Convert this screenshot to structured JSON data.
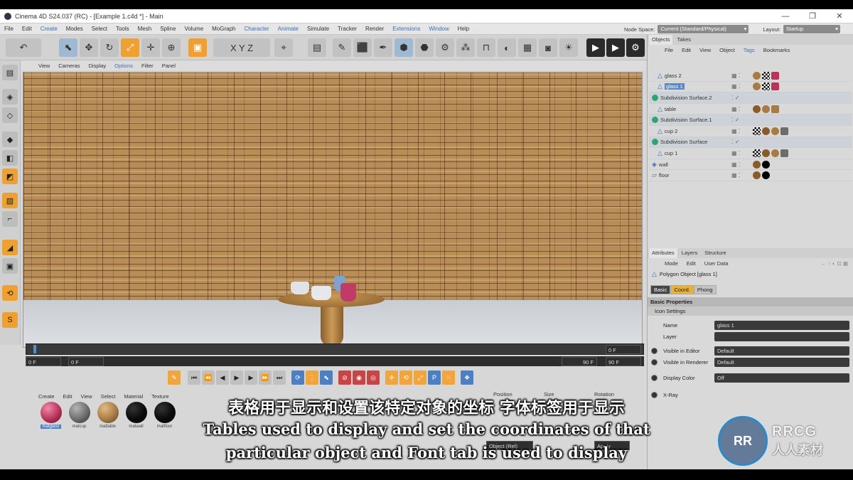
{
  "window": {
    "title": "Cinema 4D S24.037 (RC) - [Example 1.c4d *] - Main",
    "controls": [
      "—",
      "❐",
      "✕"
    ]
  },
  "menubar": {
    "items": [
      "File",
      "Edit",
      "Create",
      "Modes",
      "Select",
      "Tools",
      "Mesh",
      "Spline",
      "Volume",
      "MoGraph",
      "Character",
      "Animate",
      "Simulate",
      "Tracker",
      "Render",
      "Extensions",
      "Window",
      "Help"
    ],
    "node_space_label": "Node Space:",
    "node_space_value": "Current (Standard/Physical)",
    "layout_label": "Layout:",
    "layout_value": "Startup"
  },
  "viewport_menu": [
    "View",
    "Cameras",
    "Display",
    "Options",
    "Filter",
    "Panel"
  ],
  "timeline": {
    "start_field": "0 F",
    "current_field": "0 F",
    "end_field": "90 F",
    "end_field_right": "90 F",
    "top_right_field": "0 F"
  },
  "material_menu": [
    "Create",
    "Edit",
    "View",
    "Select",
    "Material",
    "Texture"
  ],
  "materials": [
    {
      "name": "matglass",
      "color": "#b8345a"
    },
    {
      "name": "matcup",
      "color": "#6d6d6d"
    },
    {
      "name": "mattable",
      "color": "#a87b45"
    },
    {
      "name": "matwall",
      "color": "#0a0a0a"
    },
    {
      "name": "matfloor",
      "color": "#0a0a0a"
    }
  ],
  "coords": {
    "position": "Position",
    "size": "Size",
    "rotation": "Rotation",
    "object_mode": "Object (Rel)",
    "apply": "Apply"
  },
  "objects_panel": {
    "tabs": [
      "Objects",
      "Takes"
    ],
    "menu": [
      "File",
      "Edit",
      "View",
      "Object",
      "Tags",
      "Bookmarks"
    ],
    "rows": [
      {
        "name": "glass 2",
        "indent": 1,
        "type": "tri"
      },
      {
        "name": "glass 1",
        "indent": 1,
        "type": "tri"
      },
      {
        "name": "Subdivision Surface.2",
        "indent": 0,
        "type": "sub"
      },
      {
        "name": "table",
        "indent": 1,
        "type": "tri"
      },
      {
        "name": "Subdivision Surface.1",
        "indent": 0,
        "type": "sub"
      },
      {
        "name": "cup 2",
        "indent": 1,
        "type": "tri"
      },
      {
        "name": "Subdivision Surface",
        "indent": 0,
        "type": "sub"
      },
      {
        "name": "cup 1",
        "indent": 1,
        "type": "tri"
      },
      {
        "name": "wall",
        "indent": 0,
        "type": "obj"
      },
      {
        "name": "floor",
        "indent": 0,
        "type": "obj"
      }
    ]
  },
  "attributes_panel": {
    "tabs": [
      "Attributes",
      "Layers",
      "Structure"
    ],
    "menu": [
      "Mode",
      "Edit",
      "User Data"
    ],
    "object_label": "Polygon Object [glass 1]",
    "subtabs": [
      "Basic",
      "Coord.",
      "Phong"
    ],
    "section": "Basic Properties",
    "subsection": "Icon Settings",
    "fields": [
      {
        "label": "Name",
        "value": "glass 1"
      },
      {
        "label": "Layer",
        "value": ""
      },
      {
        "label": "Visible in Editor",
        "value": "Default"
      },
      {
        "label": "Visible in Renderer",
        "value": "Default"
      },
      {
        "label": "Display Color",
        "value": "Off"
      },
      {
        "label": "X-Ray",
        "value": ""
      }
    ]
  },
  "subtitles": {
    "chinese": "表格用于显示和设置该特定对象的坐标 字体标签用于显示",
    "english_line1": "Tables used to display and set the coordinates of that",
    "english_line2": "particular object and Font tab is used to display"
  },
  "watermark": {
    "brand": "RRCG",
    "brand_cn": "人人素材"
  }
}
